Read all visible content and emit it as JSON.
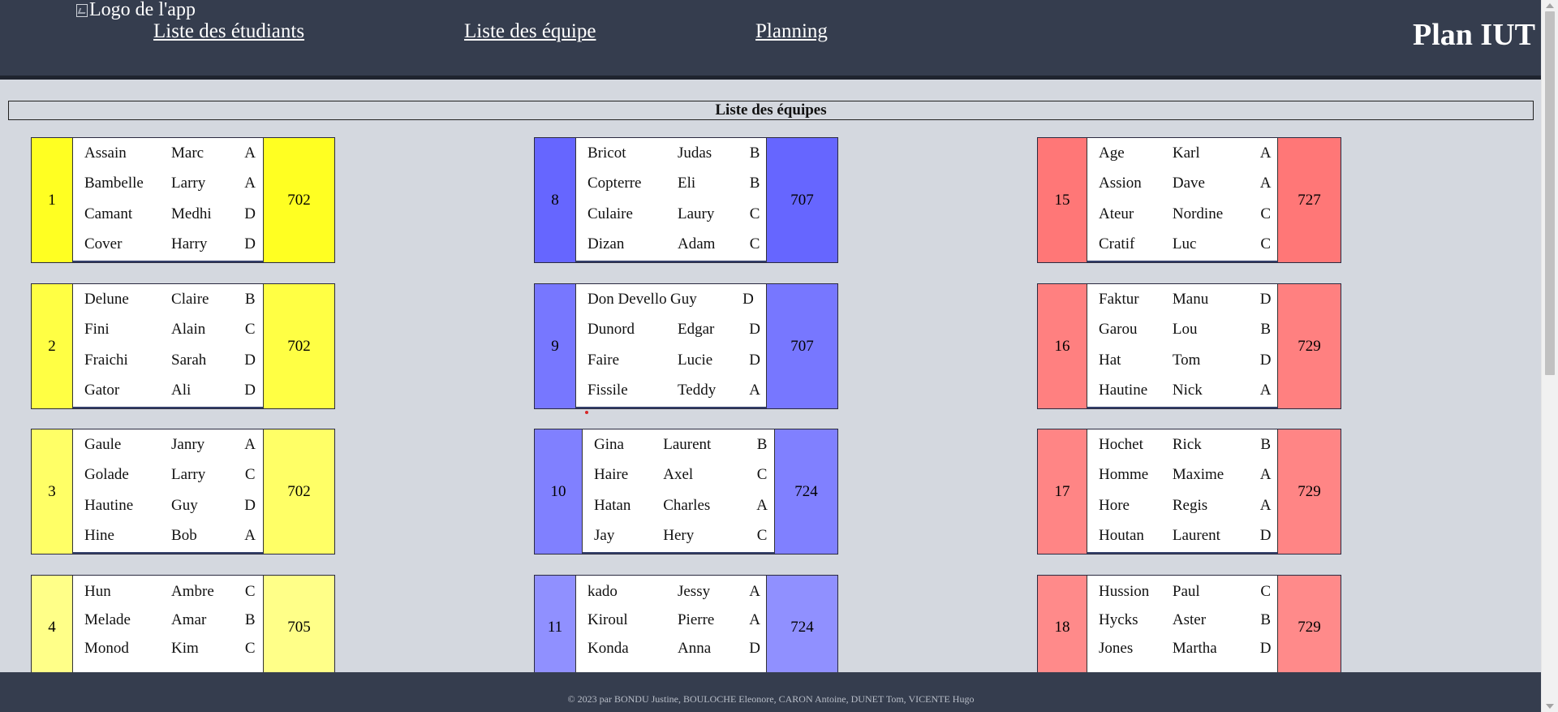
{
  "header": {
    "logo_alt": "Logo de l'app",
    "nav": [
      "Liste des étudiants",
      "Liste des équipe",
      "Planning"
    ],
    "brand": "Plan IUT"
  },
  "section_title": "Liste des équipes",
  "teams": [
    {
      "id": "1",
      "room": "702",
      "members": [
        [
          "Assain",
          "Marc",
          "A"
        ],
        [
          "Bambelle",
          "Larry",
          "A"
        ],
        [
          "Camant",
          "Medhi",
          "D"
        ],
        [
          "Cover",
          "Harry",
          "D"
        ]
      ]
    },
    {
      "id": "2",
      "room": "702",
      "members": [
        [
          "Delune",
          "Claire",
          "B"
        ],
        [
          "Fini",
          "Alain",
          "C"
        ],
        [
          "Fraichi",
          "Sarah",
          "D"
        ],
        [
          "Gator",
          "Ali",
          "D"
        ]
      ]
    },
    {
      "id": "3",
      "room": "702",
      "members": [
        [
          "Gaule",
          "Janry",
          "A"
        ],
        [
          "Golade",
          "Larry",
          "C"
        ],
        [
          "Hautine",
          "Guy",
          "D"
        ],
        [
          "Hine",
          "Bob",
          "A"
        ]
      ]
    },
    {
      "id": "4",
      "room": "705",
      "members": [
        [
          "Hun",
          "Ambre",
          "C"
        ],
        [
          "Melade",
          "Amar",
          "B"
        ],
        [
          "Monod",
          "Kim",
          "C"
        ]
      ]
    },
    {
      "id": "8",
      "room": "707",
      "members": [
        [
          "Bricot",
          "Judas",
          "B"
        ],
        [
          "Copterre",
          "Eli",
          "B"
        ],
        [
          "Culaire",
          "Laury",
          "C"
        ],
        [
          "Dizan",
          "Adam",
          "C"
        ]
      ]
    },
    {
      "id": "9",
      "room": "707",
      "members": [
        [
          "Don Devello",
          "Guy",
          "D"
        ],
        [
          "Dunord",
          "Edgar",
          "D"
        ],
        [
          "Faire",
          "Lucie",
          "D"
        ],
        [
          "Fissile",
          "Teddy",
          "A"
        ]
      ]
    },
    {
      "id": "10",
      "room": "724",
      "members": [
        [
          "Gina",
          "Laurent",
          "B"
        ],
        [
          "Haire",
          "Axel",
          "C"
        ],
        [
          "Hatan",
          "Charles",
          "A"
        ],
        [
          "Jay",
          "Hery",
          "C"
        ]
      ]
    },
    {
      "id": "11",
      "room": "724",
      "members": [
        [
          "kado",
          "Jessy",
          "A"
        ],
        [
          "Kiroul",
          "Pierre",
          "A"
        ],
        [
          "Konda",
          "Anna",
          "D"
        ]
      ]
    },
    {
      "id": "15",
      "room": "727",
      "members": [
        [
          "Age",
          "Karl",
          "A"
        ],
        [
          "Assion",
          "Dave",
          "A"
        ],
        [
          "Ateur",
          "Nordine",
          "C"
        ],
        [
          "Cratif",
          "Luc",
          "C"
        ]
      ]
    },
    {
      "id": "16",
      "room": "729",
      "members": [
        [
          "Faktur",
          "Manu",
          "D"
        ],
        [
          "Garou",
          "Lou",
          "B"
        ],
        [
          "Hat",
          "Tom",
          "D"
        ],
        [
          "Hautine",
          "Nick",
          "A"
        ]
      ]
    },
    {
      "id": "17",
      "room": "729",
      "members": [
        [
          "Hochet",
          "Rick",
          "B"
        ],
        [
          "Homme",
          "Maxime",
          "A"
        ],
        [
          "Hore",
          "Regis",
          "A"
        ],
        [
          "Houtan",
          "Laurent",
          "D"
        ]
      ]
    },
    {
      "id": "18",
      "room": "729",
      "members": [
        [
          "Hussion",
          "Paul",
          "C"
        ],
        [
          "Hycks",
          "Aster",
          "B"
        ],
        [
          "Jones",
          "Martha",
          "D"
        ]
      ]
    }
  ],
  "colors": {
    "header_bg": "#353d4e",
    "page_bg": "#d4d8df",
    "team_colors": [
      "#ffff22",
      "#ffff44",
      "#ffff66",
      "#ffff88",
      "#6666ff",
      "#7777ff",
      "#8080ff",
      "#9090ff",
      "#ff7777",
      "#ff8080",
      "#ff8585",
      "#ff8a8a"
    ]
  },
  "footer": "© 2023 par BONDU Justine, BOULOCHE Eleonore, CARON Antoine, DUNET Tom, VICENTE Hugo"
}
